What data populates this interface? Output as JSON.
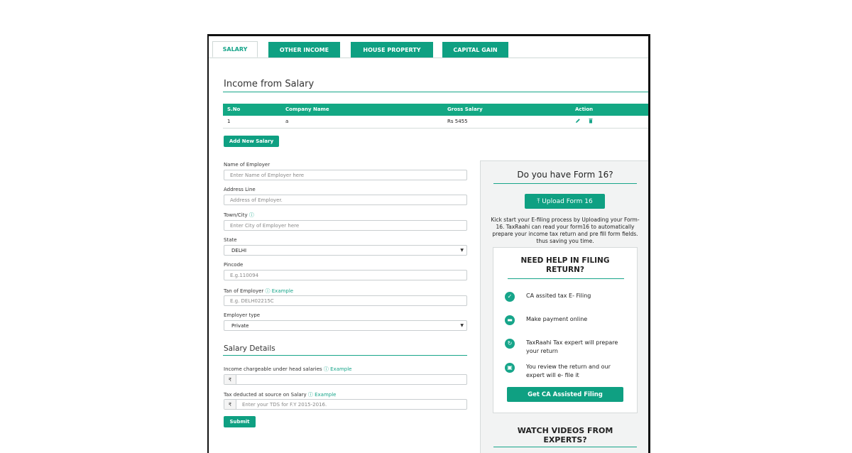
{
  "tabs": [
    {
      "label": "SALARY"
    },
    {
      "label": "OTHER INCOME"
    },
    {
      "label": "HOUSE PROPERTY"
    },
    {
      "label": "CAPITAL GAIN"
    }
  ],
  "income_section": {
    "title": "Income from Salary"
  },
  "table": {
    "headers": [
      "S.No",
      "Company Name",
      "Gross Salary",
      "Action"
    ],
    "rows": [
      {
        "sno": "1",
        "company": "a",
        "gross": "Rs 5455"
      }
    ]
  },
  "add_salary_label": "Add New Salary",
  "form": {
    "employer_name": {
      "label": "Name of Employer",
      "placeholder": "Enter Name of Employer here"
    },
    "address": {
      "label": "Address Line",
      "placeholder": "Address of Employer."
    },
    "town": {
      "label": "Town/City",
      "placeholder": "Enter City of Employer here"
    },
    "state": {
      "label": "State",
      "value": "DELHI"
    },
    "pincode": {
      "label": "Pincode",
      "placeholder": "E.g.110094"
    },
    "tan": {
      "label": "Tan of Employer",
      "example": "Example",
      "placeholder": "E.g. DELH02215C"
    },
    "employer_type": {
      "label": "Employer type",
      "value": "Private"
    }
  },
  "salary_details": {
    "title": "Salary Details",
    "income_label": "Income chargeable under head salaries",
    "income_example": "Example",
    "currency": "₹",
    "tds_label": "Tax deducted at source on Salary",
    "tds_example": "Example",
    "tds_placeholder": "Enter your TDS for F.Y 2015-2016.",
    "submit_label": "Submit"
  },
  "panel": {
    "form16_title": "Do you have Form 16?",
    "upload_label": "Upload Form 16",
    "description": "Kick start your E-filing process by Uploading your Form-16. TaxRaahi can read your form16 to automatically prepare your income tax return and pre fill form fields. thus saving you time.",
    "help_title": "NEED HELP IN FILING RETURN?",
    "help_items": [
      "CA assited tax E- Filing",
      "Make payment online",
      "TaxRaahi Tax expert will prepare your return",
      "You review the return and our expert will e- file it"
    ],
    "ca_button": "Get CA Assisted Filing",
    "videos_title": "WATCH VIDEOS FROM EXPERTS?"
  },
  "colors": {
    "accent": "#17a58a",
    "tab": "#0fa082"
  }
}
